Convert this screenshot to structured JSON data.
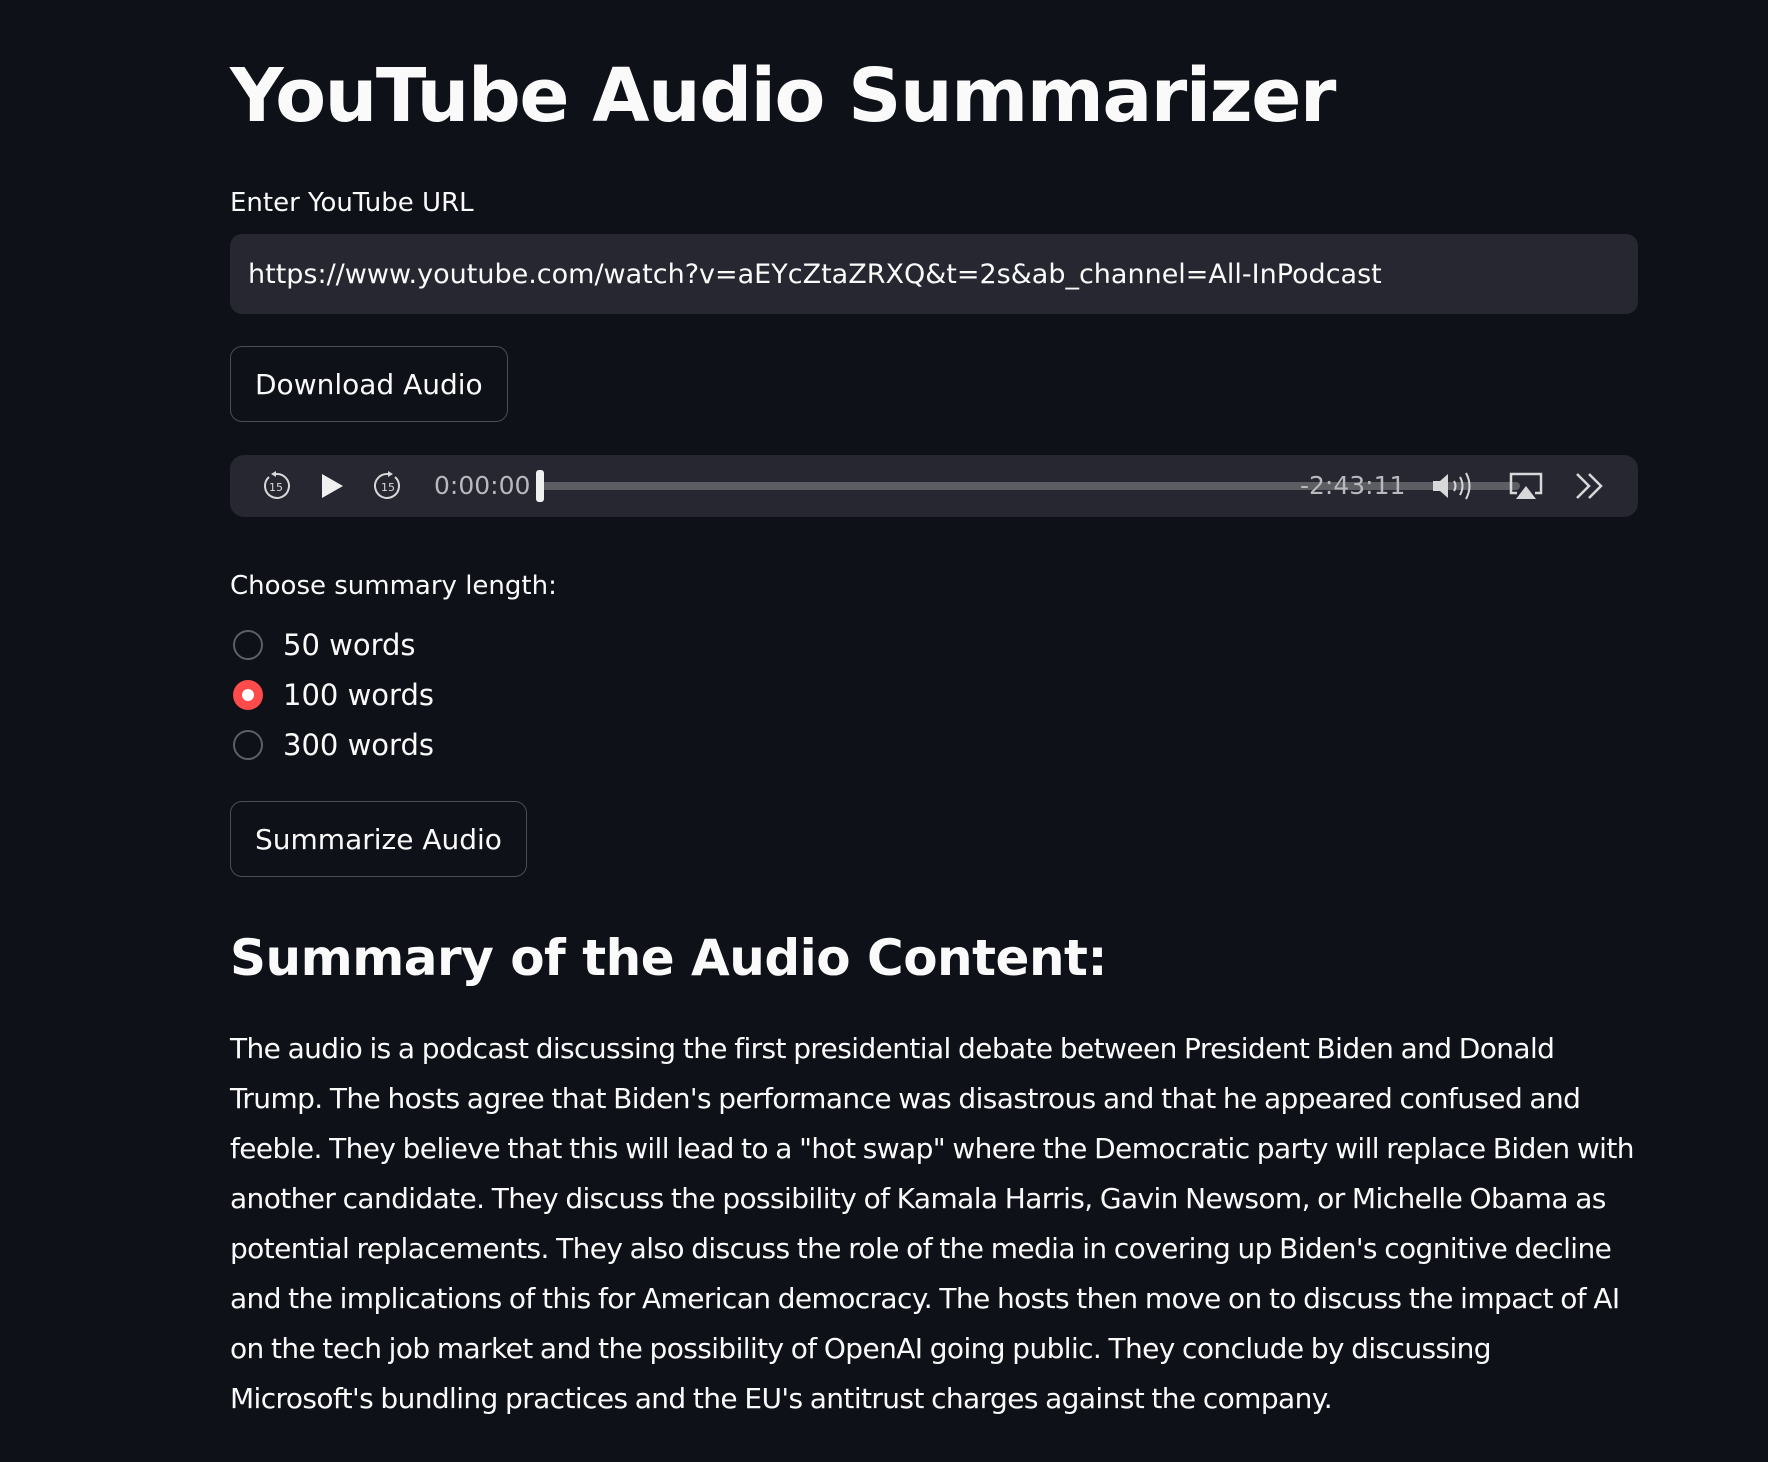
{
  "app": {
    "title": "YouTube Audio Summarizer"
  },
  "url_input": {
    "label": "Enter YouTube URL",
    "value": "https://www.youtube.com/watch?v=aEYcZtaZRXQ&t=2s&ab_channel=All-InPodcast"
  },
  "download_button": {
    "label": "Download Audio"
  },
  "audio_player": {
    "current_time": "0:00:00",
    "remaining_time": "-2:43:11",
    "progress": 0,
    "skip_back_seconds": "15",
    "skip_forward_seconds": "15",
    "icons": [
      "skip-back-15-icon",
      "play-icon",
      "skip-forward-15-icon",
      "volume-icon",
      "airplay-icon",
      "more-chevrons-icon"
    ]
  },
  "summary_length": {
    "label": "Choose summary length:",
    "options": [
      {
        "label": "50 words",
        "selected": false
      },
      {
        "label": "100 words",
        "selected": true
      },
      {
        "label": "300 words",
        "selected": false
      }
    ]
  },
  "summarize_button": {
    "label": "Summarize Audio"
  },
  "summary": {
    "heading": "Summary of the Audio Content:",
    "text": "The audio is a podcast discussing the first presidential debate between President Biden and Donald Trump. The hosts agree that Biden's performance was disastrous and that he appeared confused and feeble. They believe that this will lead to a \"hot swap\" where the Democratic party will replace Biden with another candidate. They discuss the possibility of Kamala Harris, Gavin Newsom, or Michelle Obama as potential replacements. They also discuss the role of the media in covering up Biden's cognitive decline and the implications of this for American democracy. The hosts then move on to discuss the impact of AI on the tech job market and the possibility of OpenAI going public. They conclude by discussing Microsoft's bundling practices and the EU's antitrust charges against the company."
  },
  "colors": {
    "background": "#0e1117",
    "input_background": "#262730",
    "accent": "#ff4b4b",
    "text": "#fafafa"
  }
}
